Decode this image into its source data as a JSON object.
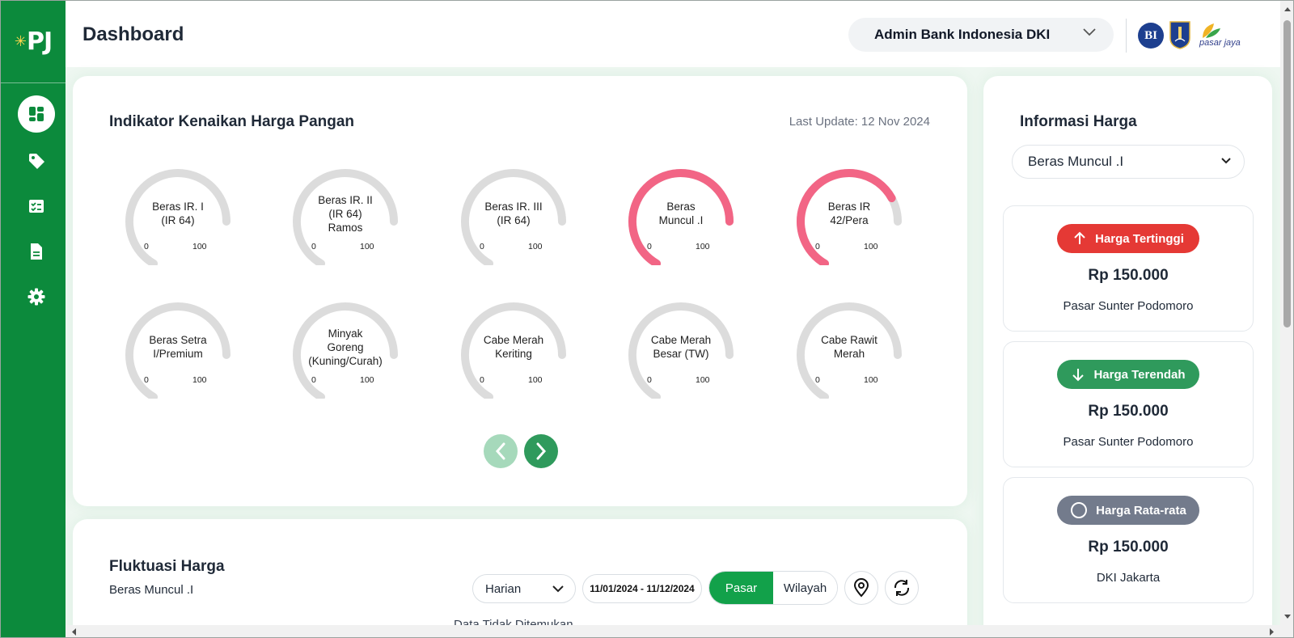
{
  "brand": {
    "sidebar_logo": "PJ",
    "partner_bi": "BI",
    "partner_pasarjaya": "pasar jaya"
  },
  "header": {
    "title": "Dashboard",
    "user_label": "Admin Bank Indonesia DKI"
  },
  "nav": [
    {
      "icon": "dashboard-icon",
      "active": true
    },
    {
      "icon": "tag-icon",
      "active": false
    },
    {
      "icon": "checklist-icon",
      "active": false
    },
    {
      "icon": "document-icon",
      "active": false
    },
    {
      "icon": "gear-icon",
      "active": false
    }
  ],
  "indikator": {
    "title": "Indikator Kenaikan Harga Pangan",
    "last_update": "Last Update: 12 Nov 2024",
    "gauges": [
      {
        "label": "Beras IR. I\n(IR 64)",
        "min": "0",
        "max": "100",
        "value": 0
      },
      {
        "label": "Beras IR. II\n(IR 64)\nRamos",
        "min": "0",
        "max": "100",
        "value": 0
      },
      {
        "label": "Beras IR. III\n(IR 64)",
        "min": "0",
        "max": "100",
        "value": 0
      },
      {
        "label": "Beras\nMuncul .I",
        "min": "0",
        "max": "100",
        "value": 100
      },
      {
        "label": "Beras IR\n42/Pera",
        "min": "0",
        "max": "100",
        "value": 88
      },
      {
        "label": "Beras Setra\nI/Premium",
        "min": "0",
        "max": "100",
        "value": 0
      },
      {
        "label": "Minyak\nGoreng\n(Kuning/Curah)",
        "min": "0",
        "max": "100",
        "value": 0
      },
      {
        "label": "Cabe Merah\nKeriting",
        "min": "0",
        "max": "100",
        "value": 0
      },
      {
        "label": "Cabe Merah\nBesar (TW)",
        "min": "0",
        "max": "100",
        "value": 0
      },
      {
        "label": "Cabe Rawit\nMerah",
        "min": "0",
        "max": "100",
        "value": 0
      }
    ],
    "colors": {
      "track": "#dcdcdc",
      "fill": "#f26585"
    }
  },
  "fluktuasi": {
    "title": "Fluktuasi Harga",
    "subtitle": "Beras Muncul .I",
    "period": "Harian",
    "date_range": "11/01/2024 - 11/12/2024",
    "toggle": [
      "Pasar",
      "Wilayah"
    ],
    "toggle_active": "Pasar",
    "partial_text": "Data Tidak Ditemukan"
  },
  "info_harga": {
    "title": "Informasi Harga",
    "selected_item": "Beras Muncul .I",
    "cards": [
      {
        "badge": "Harga Tertinggi",
        "color": "#e53935",
        "price": "Rp 150.000",
        "location": "Pasar Sunter Podomoro"
      },
      {
        "badge": "Harga Terendah",
        "color": "#2f9a5c",
        "price": "Rp 150.000",
        "location": "Pasar Sunter Podomoro"
      },
      {
        "badge": "Harga Rata-rata",
        "color": "#737b8c",
        "price": "Rp 150.000",
        "location": "DKI Jakarta"
      }
    ]
  }
}
